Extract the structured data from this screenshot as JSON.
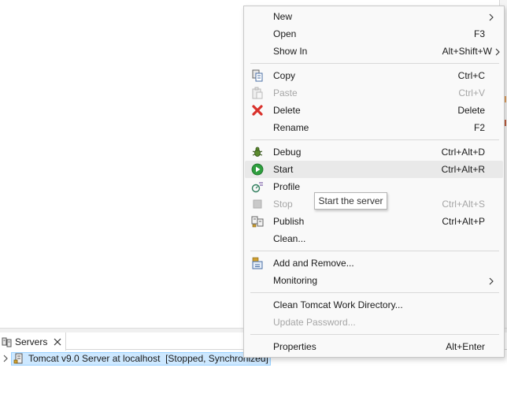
{
  "servers_view": {
    "tab_label": "Servers",
    "tree": {
      "server_label": "Tomcat v9.0 Server at localhost  [Stopped, Synchronized]"
    }
  },
  "context_menu": {
    "items": [
      {
        "label": "New",
        "accel": "",
        "submenu": true,
        "enabled": true,
        "icon": "none"
      },
      {
        "label": "Open",
        "accel": "F3",
        "submenu": false,
        "enabled": true,
        "icon": "none"
      },
      {
        "label": "Show In",
        "accel": "Alt+Shift+W",
        "submenu": true,
        "enabled": true,
        "icon": "none"
      },
      {
        "label": "Copy",
        "accel": "Ctrl+C",
        "submenu": false,
        "enabled": true,
        "icon": "copy-icon"
      },
      {
        "label": "Paste",
        "accel": "Ctrl+V",
        "submenu": false,
        "enabled": false,
        "icon": "paste-icon"
      },
      {
        "label": "Delete",
        "accel": "Delete",
        "submenu": false,
        "enabled": true,
        "icon": "delete-icon"
      },
      {
        "label": "Rename",
        "accel": "F2",
        "submenu": false,
        "enabled": true,
        "icon": "none"
      },
      {
        "label": "Debug",
        "accel": "Ctrl+Alt+D",
        "submenu": false,
        "enabled": true,
        "icon": "debug-icon"
      },
      {
        "label": "Start",
        "accel": "Ctrl+Alt+R",
        "submenu": false,
        "enabled": true,
        "icon": "start-icon"
      },
      {
        "label": "Profile",
        "accel": "",
        "submenu": false,
        "enabled": true,
        "icon": "profile-icon"
      },
      {
        "label": "Stop",
        "accel": "Ctrl+Alt+S",
        "submenu": false,
        "enabled": false,
        "icon": "stop-icon"
      },
      {
        "label": "Publish",
        "accel": "Ctrl+Alt+P",
        "submenu": false,
        "enabled": true,
        "icon": "publish-icon"
      },
      {
        "label": "Clean...",
        "accel": "",
        "submenu": false,
        "enabled": true,
        "icon": "none"
      },
      {
        "label": "Add and Remove...",
        "accel": "",
        "submenu": false,
        "enabled": true,
        "icon": "add-remove-icon"
      },
      {
        "label": "Monitoring",
        "accel": "",
        "submenu": true,
        "enabled": true,
        "icon": "none"
      },
      {
        "label": "Clean Tomcat Work Directory...",
        "accel": "",
        "submenu": false,
        "enabled": true,
        "icon": "none"
      },
      {
        "label": "Update Password...",
        "accel": "",
        "submenu": false,
        "enabled": false,
        "icon": "none"
      },
      {
        "label": "Properties",
        "accel": "Alt+Enter",
        "submenu": false,
        "enabled": true,
        "icon": "none"
      }
    ],
    "hovered_item": "Start"
  },
  "tooltip": {
    "text": "Start the server"
  },
  "colors": {
    "selection_bg": "#cde8ff",
    "start_green": "#2e9e3e",
    "delete_red": "#d9312b"
  }
}
